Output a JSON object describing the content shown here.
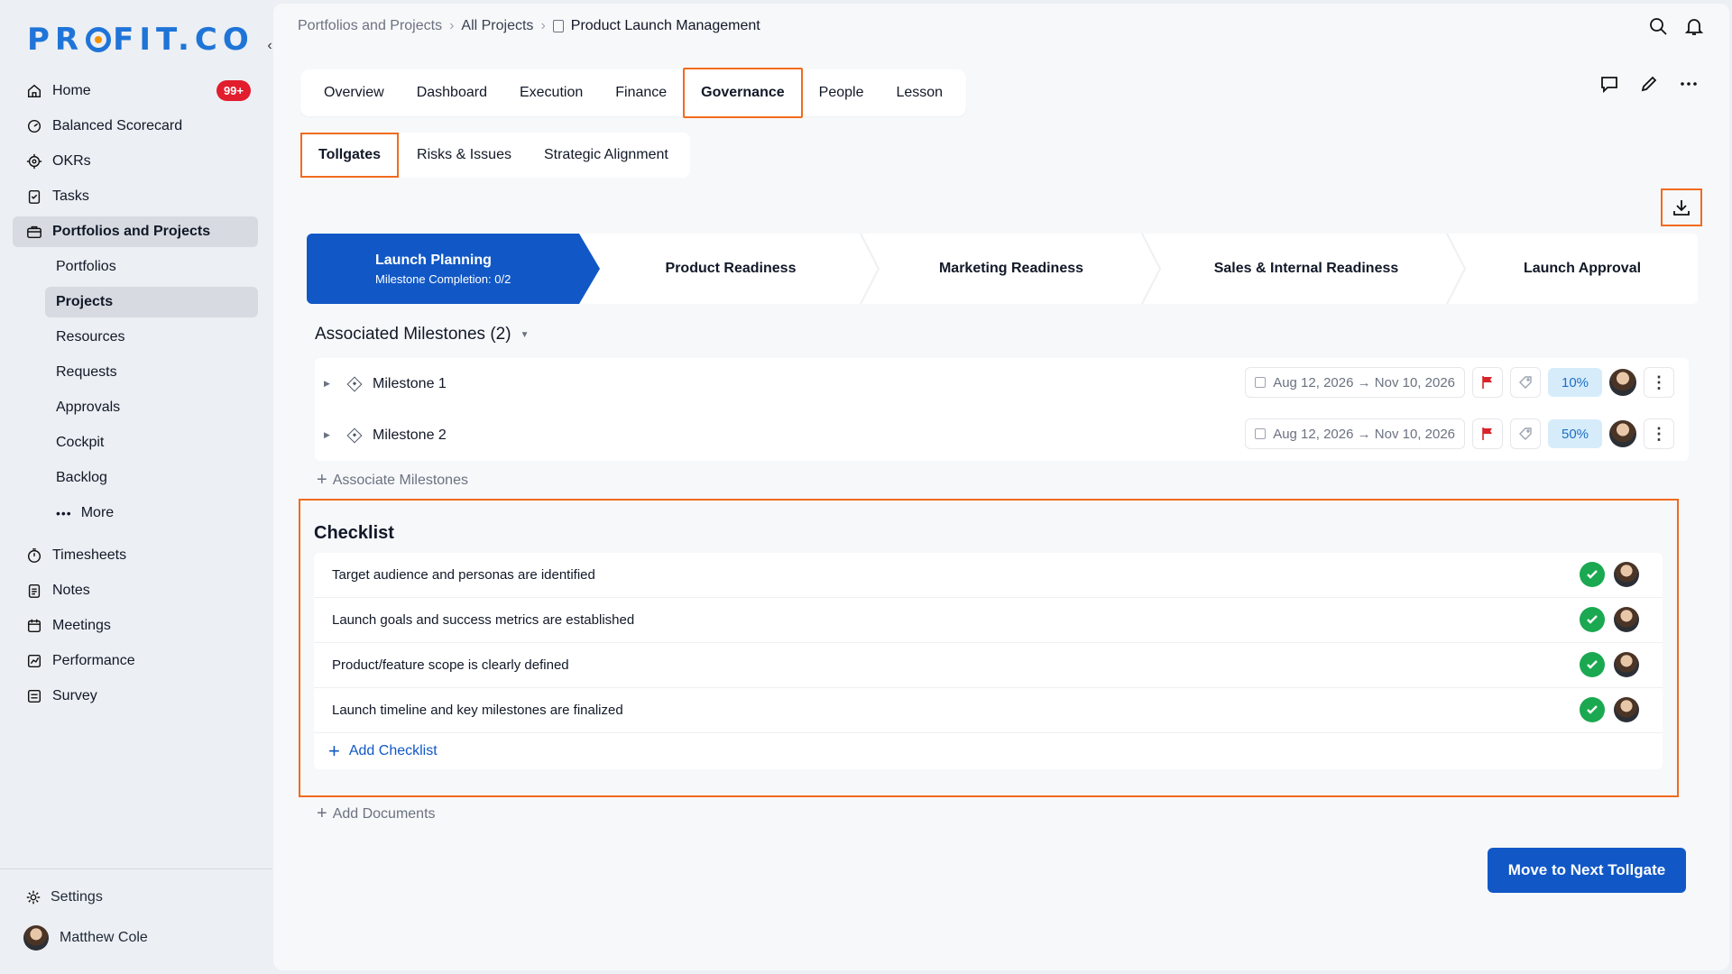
{
  "app": {
    "logo_text_before": "PR",
    "logo_text_after": "FIT.CO"
  },
  "sidebar": {
    "items": [
      {
        "label": "Home",
        "badge": "99+"
      },
      {
        "label": "Balanced Scorecard"
      },
      {
        "label": "OKRs"
      },
      {
        "label": "Tasks"
      },
      {
        "label": "Portfolios and Projects"
      }
    ],
    "sub_items": [
      {
        "label": "Portfolios"
      },
      {
        "label": "Projects"
      },
      {
        "label": "Resources"
      },
      {
        "label": "Requests"
      },
      {
        "label": "Approvals"
      },
      {
        "label": "Cockpit"
      },
      {
        "label": "Backlog"
      },
      {
        "label": "More"
      }
    ],
    "lower_items": [
      {
        "label": "Timesheets"
      },
      {
        "label": "Notes"
      },
      {
        "label": "Meetings"
      },
      {
        "label": "Performance"
      },
      {
        "label": "Survey"
      }
    ],
    "settings_label": "Settings",
    "user_name": "Matthew Cole"
  },
  "breadcrumb": {
    "root": "Portfolios and Projects",
    "mid": "All Projects",
    "current": "Product Launch Management"
  },
  "tabs": [
    "Overview",
    "Dashboard",
    "Execution",
    "Finance",
    "Governance",
    "People",
    "Lesson"
  ],
  "active_tab": "Governance",
  "subtabs": [
    "Tollgates",
    "Risks & Issues",
    "Strategic Alignment"
  ],
  "active_subtab": "Tollgates",
  "stepper": {
    "steps": [
      "Launch Planning",
      "Product Readiness",
      "Marketing Readiness",
      "Sales & Internal Readiness",
      "Launch Approval"
    ],
    "active_subtext": "Milestone Completion: 0/2"
  },
  "milestones": {
    "title": "Associated Milestones",
    "count": "(2)",
    "items": [
      {
        "name": "Milestone 1",
        "dates": "Aug 12, 2026 → Nov 10, 2026",
        "progress": "10%"
      },
      {
        "name": "Milestone 2",
        "dates": "Aug 12, 2026 → Nov 10, 2026",
        "progress": "50%"
      }
    ],
    "add_label": "Associate Milestones"
  },
  "checklist": {
    "title": "Checklist",
    "items": [
      "Target audience and personas are identified",
      "Launch goals and success metrics are established",
      "Product/feature scope is clearly defined",
      "Launch timeline and key milestones are finalized"
    ],
    "add_label": "Add Checklist"
  },
  "add_documents_label": "Add Documents",
  "next_button_label": "Move to Next Tollgate",
  "colors": {
    "primary": "#1158c6",
    "highlight": "#f26b1d",
    "success": "#1aa851",
    "badge": "#e11d2e"
  }
}
